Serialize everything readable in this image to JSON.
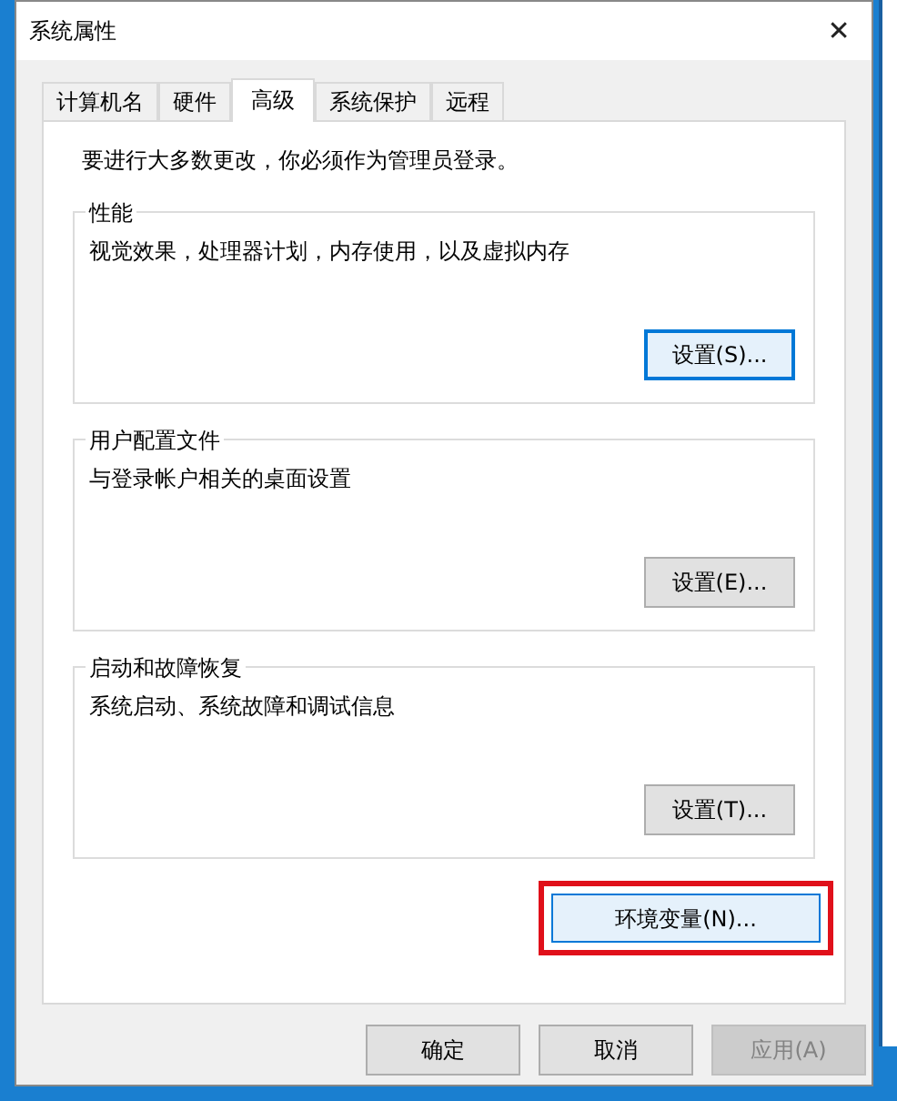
{
  "window": {
    "title": "系统属性",
    "close": "✕"
  },
  "tabs": [
    {
      "label": "计算机名",
      "selected": false
    },
    {
      "label": "硬件",
      "selected": false
    },
    {
      "label": "高级",
      "selected": true
    },
    {
      "label": "系统保护",
      "selected": false
    },
    {
      "label": "远程",
      "selected": false
    }
  ],
  "notice": "要进行大多数更改，你必须作为管理员登录。",
  "groups": [
    {
      "title": "性能",
      "description": "视觉效果，处理器计划，内存使用，以及虚拟内存",
      "button": {
        "label": "设置(S)...",
        "focused": true
      }
    },
    {
      "title": "用户配置文件",
      "description": "与登录帐户相关的桌面设置",
      "button": {
        "label": "设置(E)...",
        "focused": false
      }
    },
    {
      "title": "启动和故障恢复",
      "description": "系统启动、系统故障和调试信息",
      "button": {
        "label": "设置(T)...",
        "focused": false
      }
    }
  ],
  "env_button": {
    "label": "环境变量(N)...",
    "highlighted": true
  },
  "footer_buttons": [
    {
      "label": "确定",
      "disabled": false
    },
    {
      "label": "取消",
      "disabled": false
    },
    {
      "label": "应用(A)",
      "disabled": true
    }
  ]
}
